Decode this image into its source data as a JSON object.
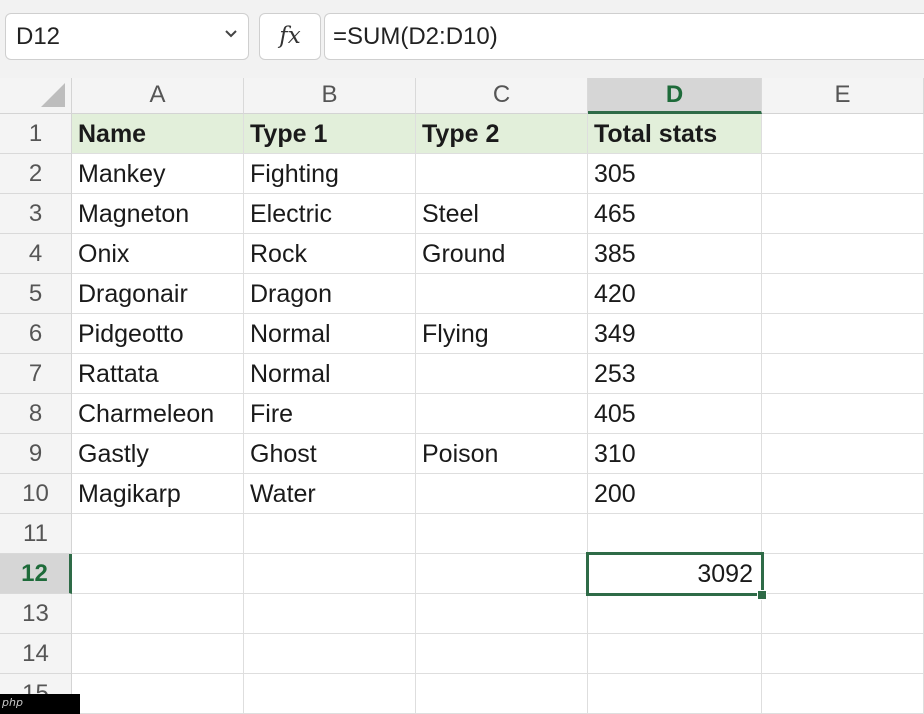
{
  "name_box": {
    "value": "D12",
    "icon": "chevron-down-icon"
  },
  "fx_button": {
    "label": "fx"
  },
  "formula_bar": {
    "value": "=SUM(D2:D10)"
  },
  "columns": [
    "A",
    "B",
    "C",
    "D",
    "E"
  ],
  "active_column": "D",
  "rows": [
    "1",
    "2",
    "3",
    "4",
    "5",
    "6",
    "7",
    "8",
    "9",
    "10",
    "11",
    "12",
    "13",
    "14",
    "15"
  ],
  "active_row": "12",
  "table": {
    "headers": [
      "Name",
      "Type 1",
      "Type 2",
      "Total stats"
    ],
    "rows": [
      [
        "Mankey",
        "Fighting",
        "",
        "305"
      ],
      [
        "Magneton",
        "Electric",
        "Steel",
        "465"
      ],
      [
        "Onix",
        "Rock",
        "Ground",
        "385"
      ],
      [
        "Dragonair",
        "Dragon",
        "",
        "420"
      ],
      [
        "Pidgeotto",
        "Normal",
        "Flying",
        "349"
      ],
      [
        "Rattata",
        "Normal",
        "",
        "253"
      ],
      [
        "Charmeleon",
        "Fire",
        "",
        "405"
      ],
      [
        "Gastly",
        "Ghost",
        "Poison",
        "310"
      ],
      [
        "Magikarp",
        "Water",
        "",
        "200"
      ]
    ]
  },
  "selected_cell": {
    "ref": "D12",
    "value": "3092"
  },
  "watermark": {
    "text": "php"
  },
  "colors": {
    "header_fill": "#e2efda",
    "selection": "#2e6b47",
    "active_header_text": "#1e6b3a"
  }
}
